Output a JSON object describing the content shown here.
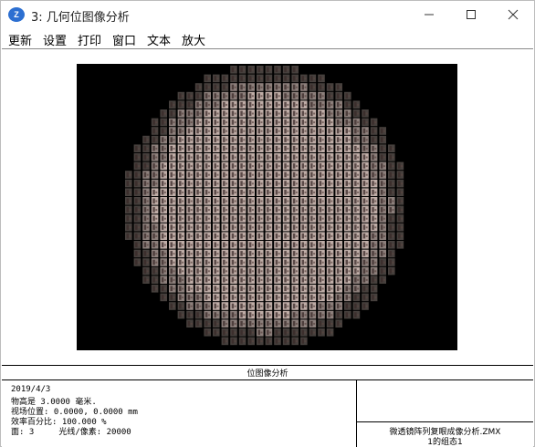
{
  "window": {
    "title": "3: 几何位图像分析",
    "icon_label": "Z"
  },
  "menu": [
    "更新",
    "设置",
    "打印",
    "窗口",
    "文本",
    "放大"
  ],
  "plot": {
    "background": "#000000",
    "spot_color": "#c9b6b0"
  },
  "caption": "位图像分析",
  "info": {
    "date": "2019/4/3",
    "object_height": "物高是 3.0000 毫米.",
    "field_position": "视场位置: 0.0000, 0.0000 mm",
    "efficiency": "效率百分比: 100.000 %",
    "surface_rays": "面: 3     光线/像素: 20000"
  },
  "file": {
    "name": "微透镜阵列复眼成像分析.ZMX",
    "config": "1的组态1"
  }
}
